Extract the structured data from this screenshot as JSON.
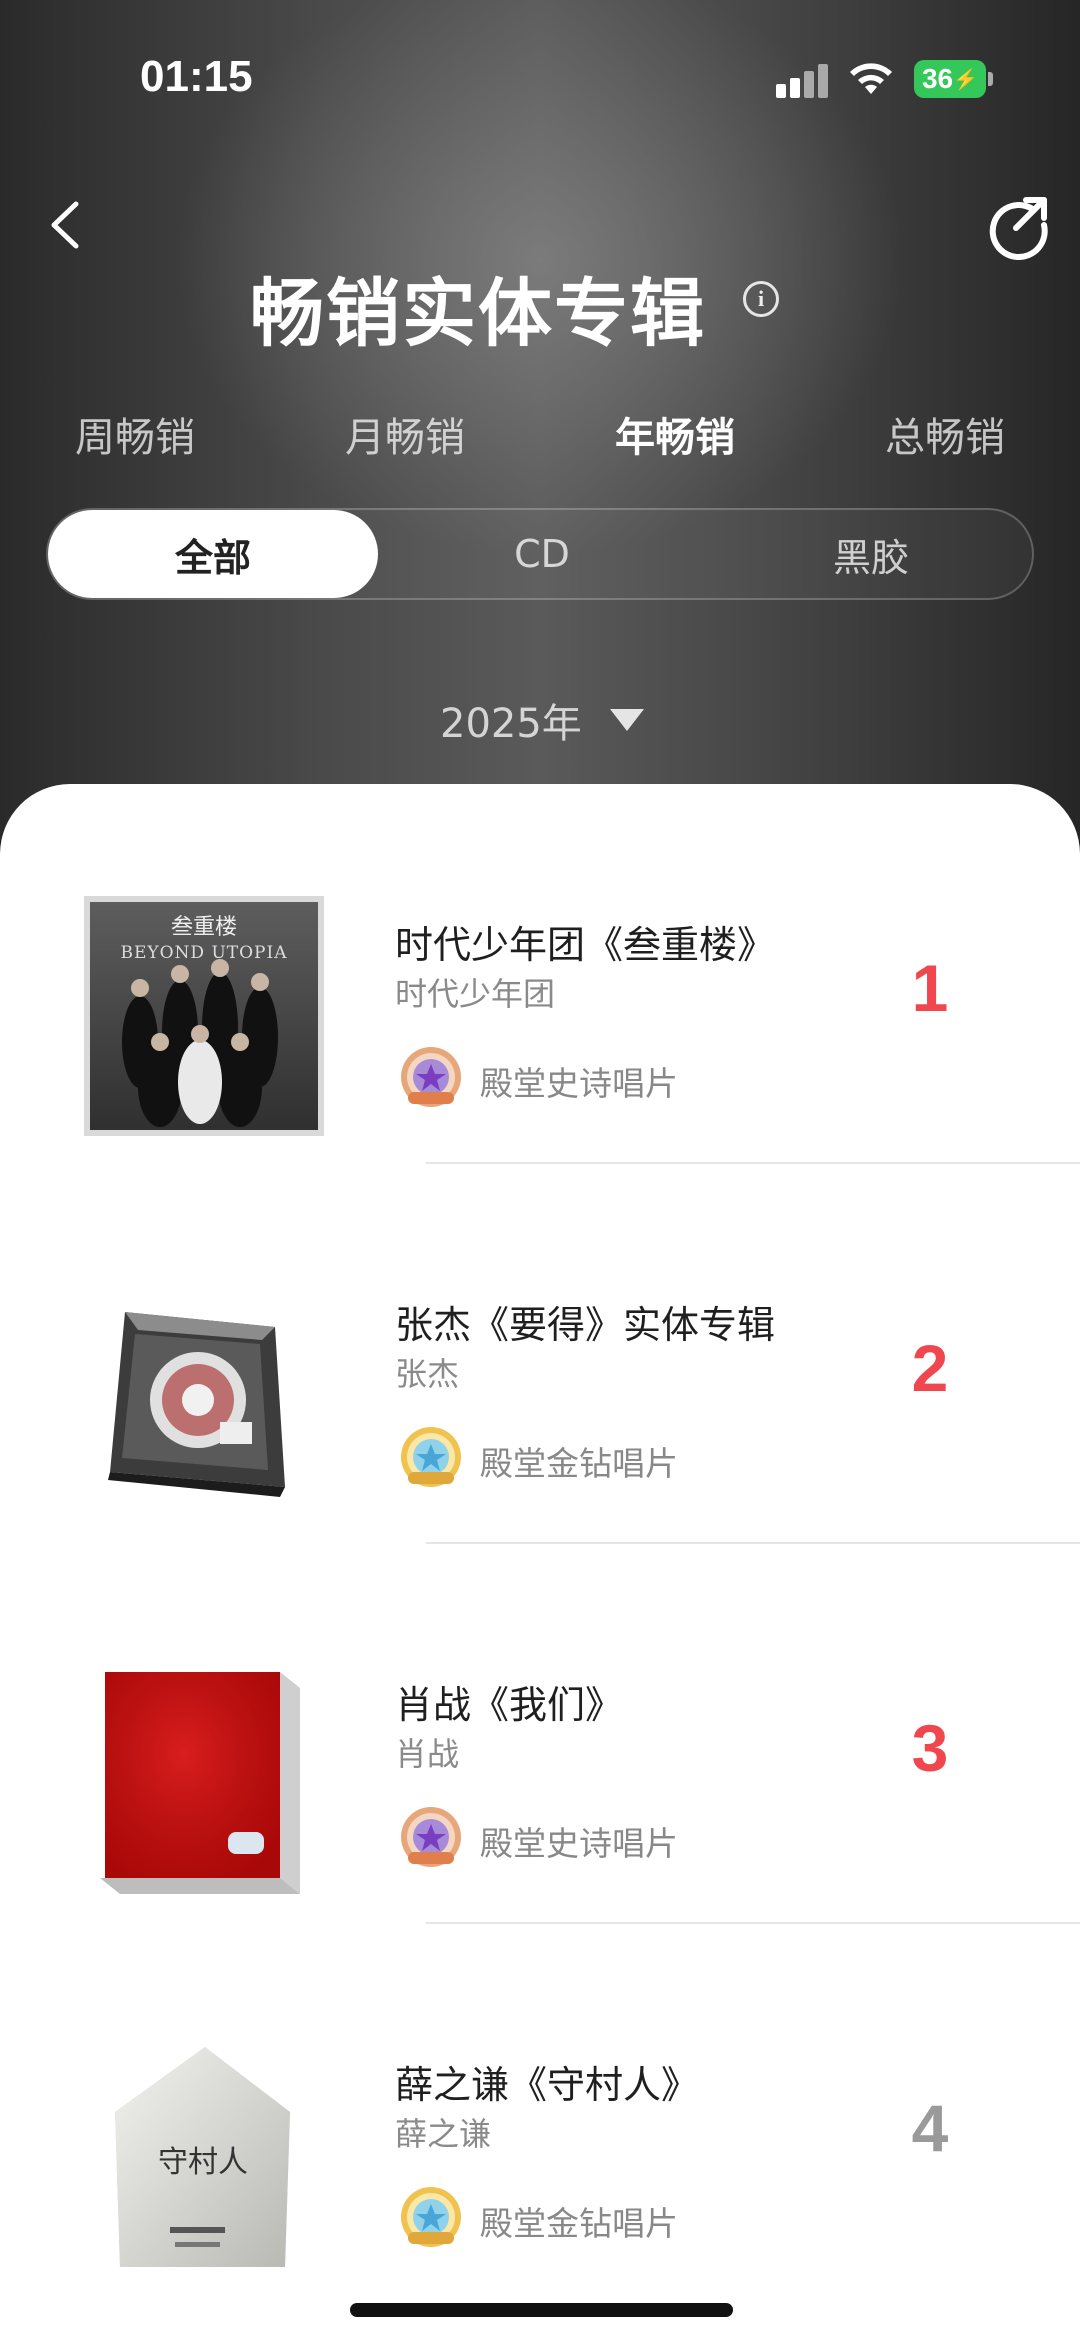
{
  "status_bar": {
    "time": "01:15",
    "battery": "36"
  },
  "header": {
    "title": "畅销实体专辑",
    "info_icon": "info-icon",
    "back_icon": "chevron-left-icon",
    "share_icon": "share-icon"
  },
  "period_tabs": [
    {
      "label": "周畅销",
      "active": false
    },
    {
      "label": "月畅销",
      "active": false
    },
    {
      "label": "年畅销",
      "active": true
    },
    {
      "label": "总畅销",
      "active": false
    }
  ],
  "format_filter": [
    {
      "label": "全部",
      "active": true
    },
    {
      "label": "CD",
      "active": false
    },
    {
      "label": "黑胶",
      "active": false
    }
  ],
  "year_selector": {
    "value": "2025年"
  },
  "albums": [
    {
      "title": "时代少年团《叁重楼》",
      "artist": "时代少年团",
      "badge": "殿堂史诗唱片",
      "badge_type": "epic",
      "rank": "1",
      "rank_color": "#f0474f"
    },
    {
      "title": "张杰《要得》实体专辑",
      "artist": "张杰",
      "badge": "殿堂金钻唱片",
      "badge_type": "diamond",
      "rank": "2",
      "rank_color": "#f0474f"
    },
    {
      "title": "肖战《我们》",
      "artist": "肖战",
      "badge": "殿堂史诗唱片",
      "badge_type": "epic",
      "rank": "3",
      "rank_color": "#f0474f"
    },
    {
      "title": "薛之谦《守村人》",
      "artist": "薛之谦",
      "badge": "殿堂金钻唱片",
      "badge_type": "diamond",
      "rank": "4",
      "rank_color": "#9a9a9a"
    }
  ],
  "cover_art": {
    "album1_title": "叁重楼",
    "album1_subtitle": "BEYOND UTOPIA",
    "album4_title": "守村人"
  },
  "colors": {
    "accent_rank": "#f0474f",
    "rank_gray": "#9a9a9a",
    "battery": "#34c759"
  }
}
